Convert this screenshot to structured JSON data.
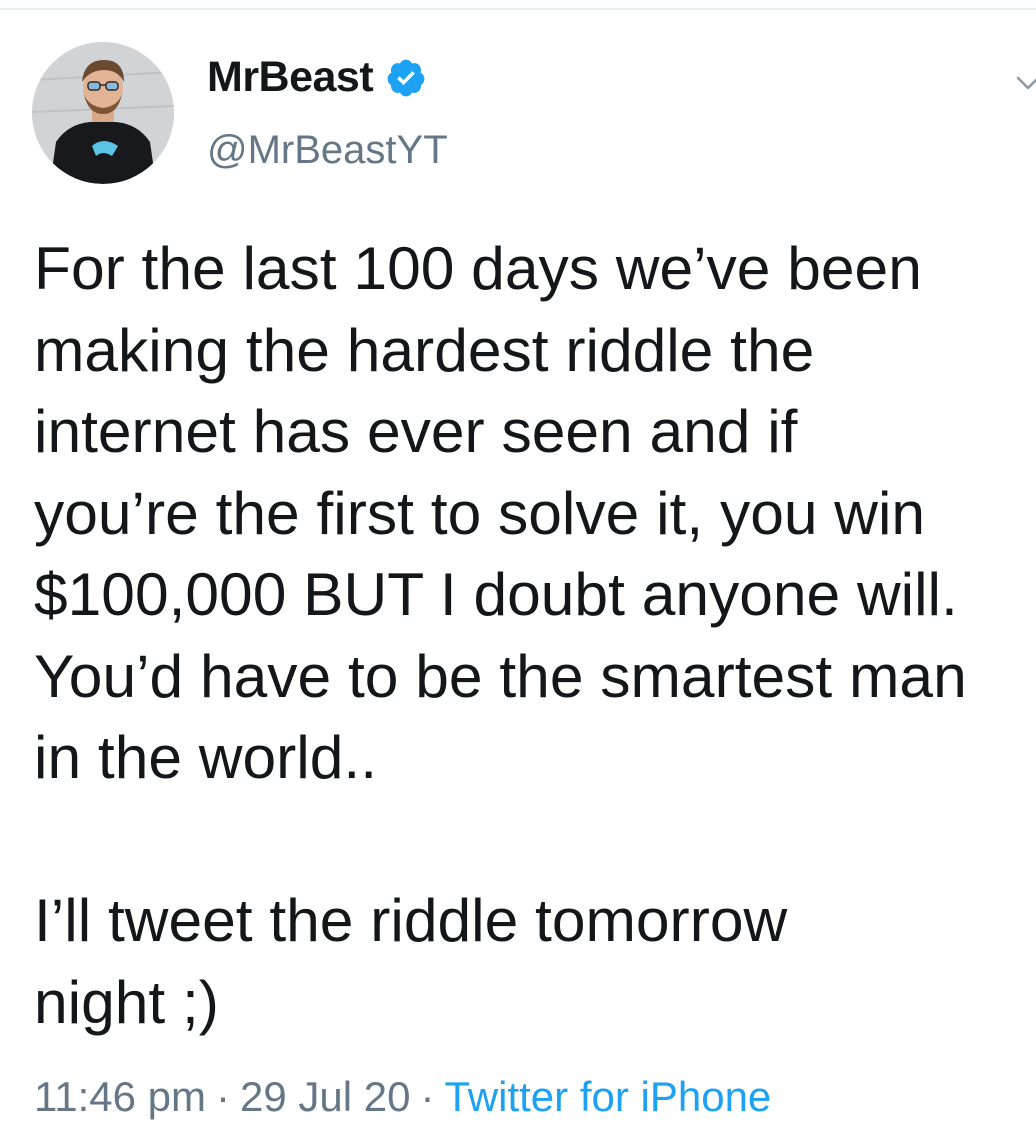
{
  "tweet": {
    "author": {
      "display_name": "MrBeast",
      "handle": "@MrBeastYT",
      "verified": true,
      "verified_color": "#1da1f2"
    },
    "text": "For the last 100 days we’ve been\nmaking the hardest riddle the\ninternet has ever seen and if\nyou’re the first to solve it, you win\n$100,000 BUT I doubt anyone will.\nYou’d have to be the smartest man\nin the world..\n\nI’ll tweet the riddle tomorrow\nnight ;)",
    "meta": {
      "time": "11:46 pm",
      "separator": "·",
      "date": "29 Jul 20",
      "source": "Twitter for iPhone"
    }
  },
  "icons": {
    "avatar": "avatar-photo",
    "verified": "verified-badge-icon",
    "menu": "chevron-down-icon"
  },
  "colors": {
    "text_primary": "#14171a",
    "text_secondary": "#657786",
    "link": "#1da1f2",
    "divider": "#e6ecf0"
  }
}
